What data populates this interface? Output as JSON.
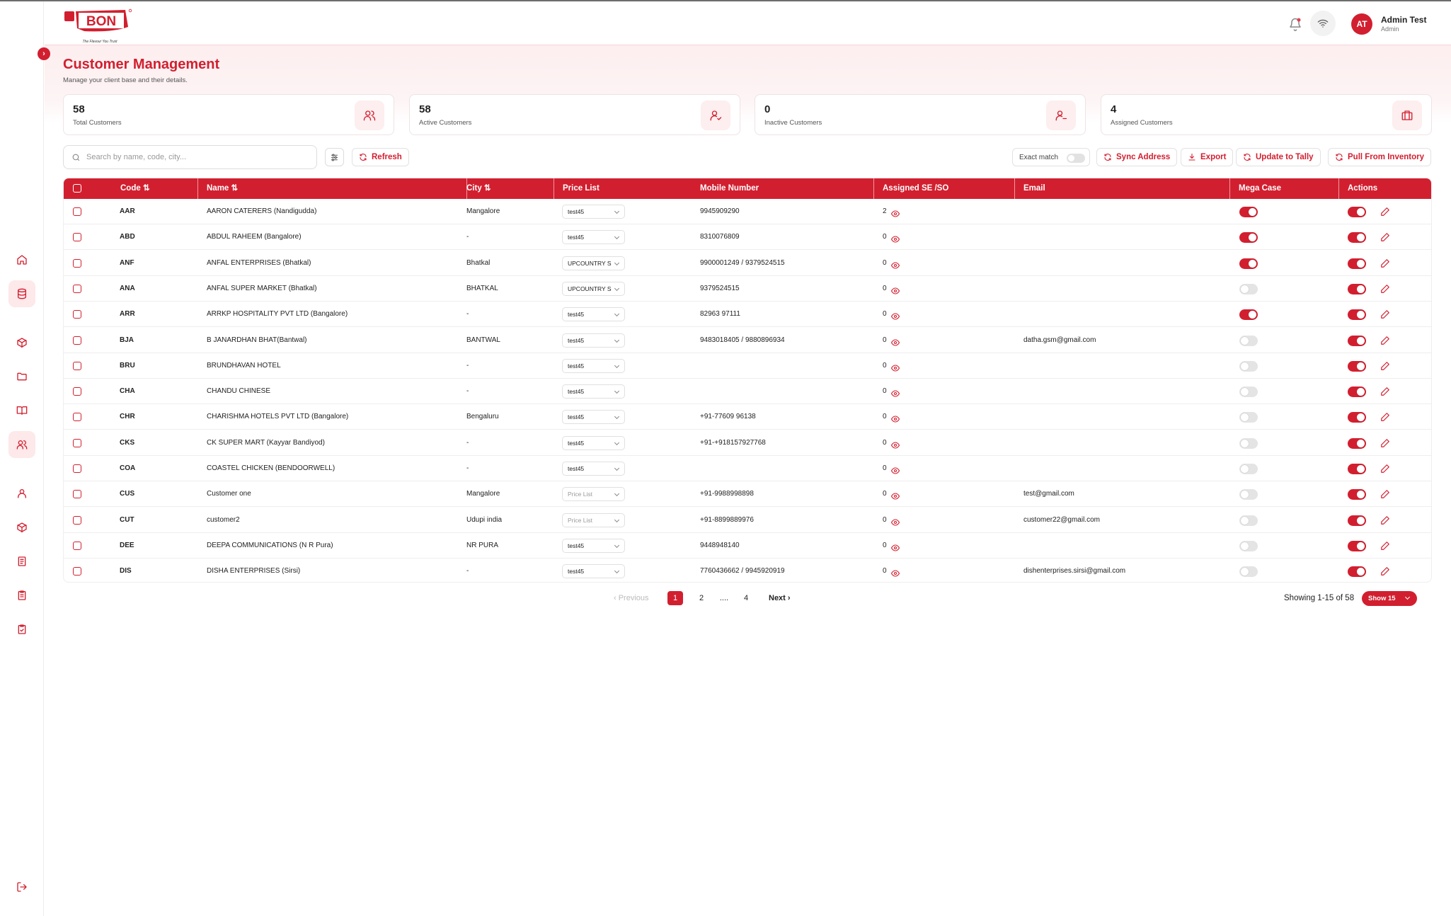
{
  "app": {
    "logo_text": "BON",
    "logo_tagline": "The Flavour You Trust",
    "user_initials": "AT",
    "user_name": "Admin Test",
    "user_role": "Admin"
  },
  "sidebar": {
    "items": [
      {
        "icon": "home-icon",
        "active": false
      },
      {
        "icon": "database-icon",
        "active": true
      },
      {
        "icon": "package-icon",
        "active": false
      },
      {
        "icon": "folder-icon",
        "active": false
      },
      {
        "icon": "book-icon",
        "active": false
      },
      {
        "icon": "users-icon",
        "active": true
      },
      {
        "icon": "user-icon",
        "active": false
      },
      {
        "icon": "box-icon",
        "active": false
      },
      {
        "icon": "document-icon",
        "active": false
      },
      {
        "icon": "clipboard-icon",
        "active": false
      },
      {
        "icon": "clipboard-check-icon",
        "active": false
      },
      {
        "icon": "logout-icon",
        "active": false
      }
    ]
  },
  "page": {
    "title": "Customer Management",
    "subtitle": "Manage your client base and their details."
  },
  "stats": [
    {
      "value": "58",
      "label": "Total Customers",
      "icon": "users-icon"
    },
    {
      "value": "58",
      "label": "Active Customers",
      "icon": "user-check-icon"
    },
    {
      "value": "0",
      "label": "Inactive Customers",
      "icon": "user-minus-icon"
    },
    {
      "value": "4",
      "label": "Assigned Customers",
      "icon": "briefcase-icon"
    }
  ],
  "toolbar": {
    "search_placeholder": "Search by name, code, city...",
    "refresh": "Refresh",
    "exact_match": "Exact match",
    "sync_address": "Sync Address",
    "export": "Export",
    "update_tally": "Update to Tally",
    "pull_inventory": "Pull From Inventory"
  },
  "table": {
    "headers": {
      "code": "Code",
      "name": "Name",
      "city": "City",
      "price_list": "Price List",
      "mobile": "Mobile Number",
      "assigned": "Assigned SE /SO",
      "email": "Email",
      "mega_case": "Mega Case",
      "actions": "Actions"
    },
    "rows": [
      {
        "code": "AAR",
        "name": "AARON CATERERS (Nandigudda)",
        "city": "Mangalore",
        "price": "test45",
        "mobile": "9945909290",
        "assigned": "2",
        "email": "",
        "mega": true,
        "active": true
      },
      {
        "code": "ABD",
        "name": "ABDUL RAHEEM (Bangalore)",
        "city": "-",
        "price": "test45",
        "mobile": "8310076809",
        "assigned": "0",
        "email": "",
        "mega": true,
        "active": true
      },
      {
        "code": "ANF",
        "name": "ANFAL ENTERPRISES (Bhatkal)",
        "city": "Bhatkal",
        "price": "UPCOUNTRY SPECIAL",
        "mobile": "9900001249 / 9379524515",
        "assigned": "0",
        "email": "",
        "mega": true,
        "active": true
      },
      {
        "code": "ANA",
        "name": "ANFAL SUPER MARKET (Bhatkal)",
        "city": "BHATKAL",
        "price": "UPCOUNTRY SPECIAL",
        "mobile": "9379524515",
        "assigned": "0",
        "email": "",
        "mega": false,
        "active": true
      },
      {
        "code": "ARR",
        "name": "ARRKP HOSPITALITY PVT LTD (Bangalore)",
        "city": "-",
        "price": "test45",
        "mobile": "82963 97111",
        "assigned": "0",
        "email": "",
        "mega": true,
        "active": true
      },
      {
        "code": "BJA",
        "name": "B JANARDHAN BHAT(Bantwal)",
        "city": "BANTWAL",
        "price": "test45",
        "mobile": "9483018405 / 9880896934",
        "assigned": "0",
        "email": "datha.gsm@gmail.com",
        "mega": false,
        "active": true
      },
      {
        "code": "BRU",
        "name": "BRUNDHAVAN HOTEL",
        "city": "-",
        "price": "test45",
        "mobile": "",
        "assigned": "0",
        "email": "",
        "mega": false,
        "active": true
      },
      {
        "code": "CHA",
        "name": "CHANDU CHINESE",
        "city": "-",
        "price": "test45",
        "mobile": "",
        "assigned": "0",
        "email": "",
        "mega": false,
        "active": true
      },
      {
        "code": "CHR",
        "name": "CHARISHMA HOTELS PVT LTD (Bangalore)",
        "city": "Bengaluru",
        "price": "test45",
        "mobile": "+91-77609 96138",
        "assigned": "0",
        "email": "",
        "mega": false,
        "active": true
      },
      {
        "code": "CKS",
        "name": "CK SUPER MART (Kayyar Bandiyod)",
        "city": "-",
        "price": "test45",
        "mobile": "+91-+918157927768",
        "assigned": "0",
        "email": "",
        "mega": false,
        "active": true
      },
      {
        "code": "COA",
        "name": "COASTEL CHICKEN (BENDOORWELL)",
        "city": "-",
        "price": "test45",
        "mobile": "",
        "assigned": "0",
        "email": "",
        "mega": false,
        "active": true
      },
      {
        "code": "CUS",
        "name": "Customer one",
        "city": "Mangalore",
        "price": "",
        "mobile": "+91-9988998898",
        "assigned": "0",
        "email": "test@gmail.com",
        "mega": false,
        "active": true
      },
      {
        "code": "CUT",
        "name": "customer2",
        "city": "Udupi india",
        "price": "",
        "mobile": "+91-8899889976",
        "assigned": "0",
        "email": "customer22@gmail.com",
        "mega": false,
        "active": true
      },
      {
        "code": "DEE",
        "name": "DEEPA COMMUNICATIONS (N R Pura)",
        "city": "NR PURA",
        "price": "test45",
        "mobile": "9448948140",
        "assigned": "0",
        "email": "",
        "mega": false,
        "active": true
      },
      {
        "code": "DIS",
        "name": "DISHA ENTERPRISES (Sirsi)",
        "city": "-",
        "price": "test45",
        "mobile": "7760436662 / 9945920919",
        "assigned": "0",
        "email": "dishenterprises.sirsi@gmail.com",
        "mega": false,
        "active": true
      }
    ],
    "price_placeholder": "Price List"
  },
  "pagination": {
    "previous": "‹ Previous",
    "pages": [
      "1",
      "2",
      "....",
      "4"
    ],
    "current": "1",
    "next": "Next ›",
    "showing": "Showing 1-15 of 58",
    "show_select": "Show 15"
  },
  "colors": {
    "brand": "#d21f2f",
    "banner": "#fdeeef"
  }
}
